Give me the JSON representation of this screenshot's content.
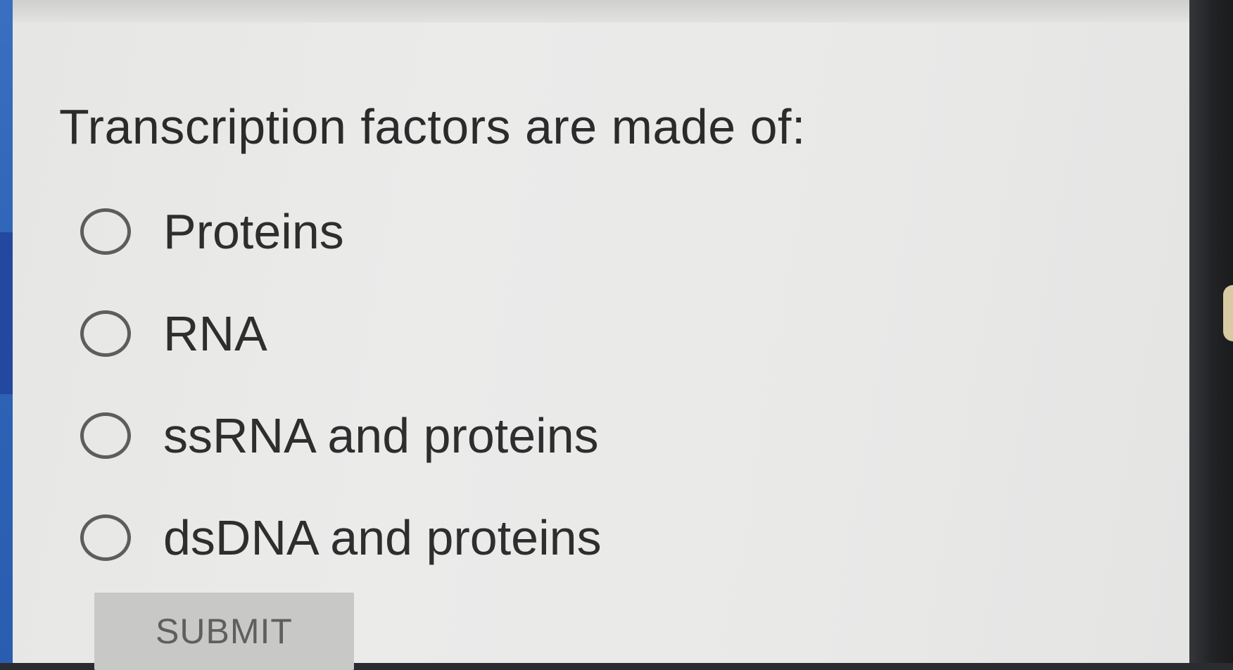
{
  "question": {
    "text": "Transcription factors are made of:"
  },
  "options": [
    {
      "label": "Proteins",
      "selected": false
    },
    {
      "label": "RNA",
      "selected": false
    },
    {
      "label": "ssRNA and proteins",
      "selected": false
    },
    {
      "label": "dsDNA and proteins",
      "selected": false
    }
  ],
  "submit": {
    "label": "SUBMIT",
    "enabled": false
  },
  "colors": {
    "card_background": "#e8e8e7",
    "text": "#2b2b2b",
    "radio_border": "#5d5d5d",
    "submit_background": "#c8c8c7",
    "submit_text": "#5f5f5f",
    "left_accent": "#2f64b8"
  }
}
